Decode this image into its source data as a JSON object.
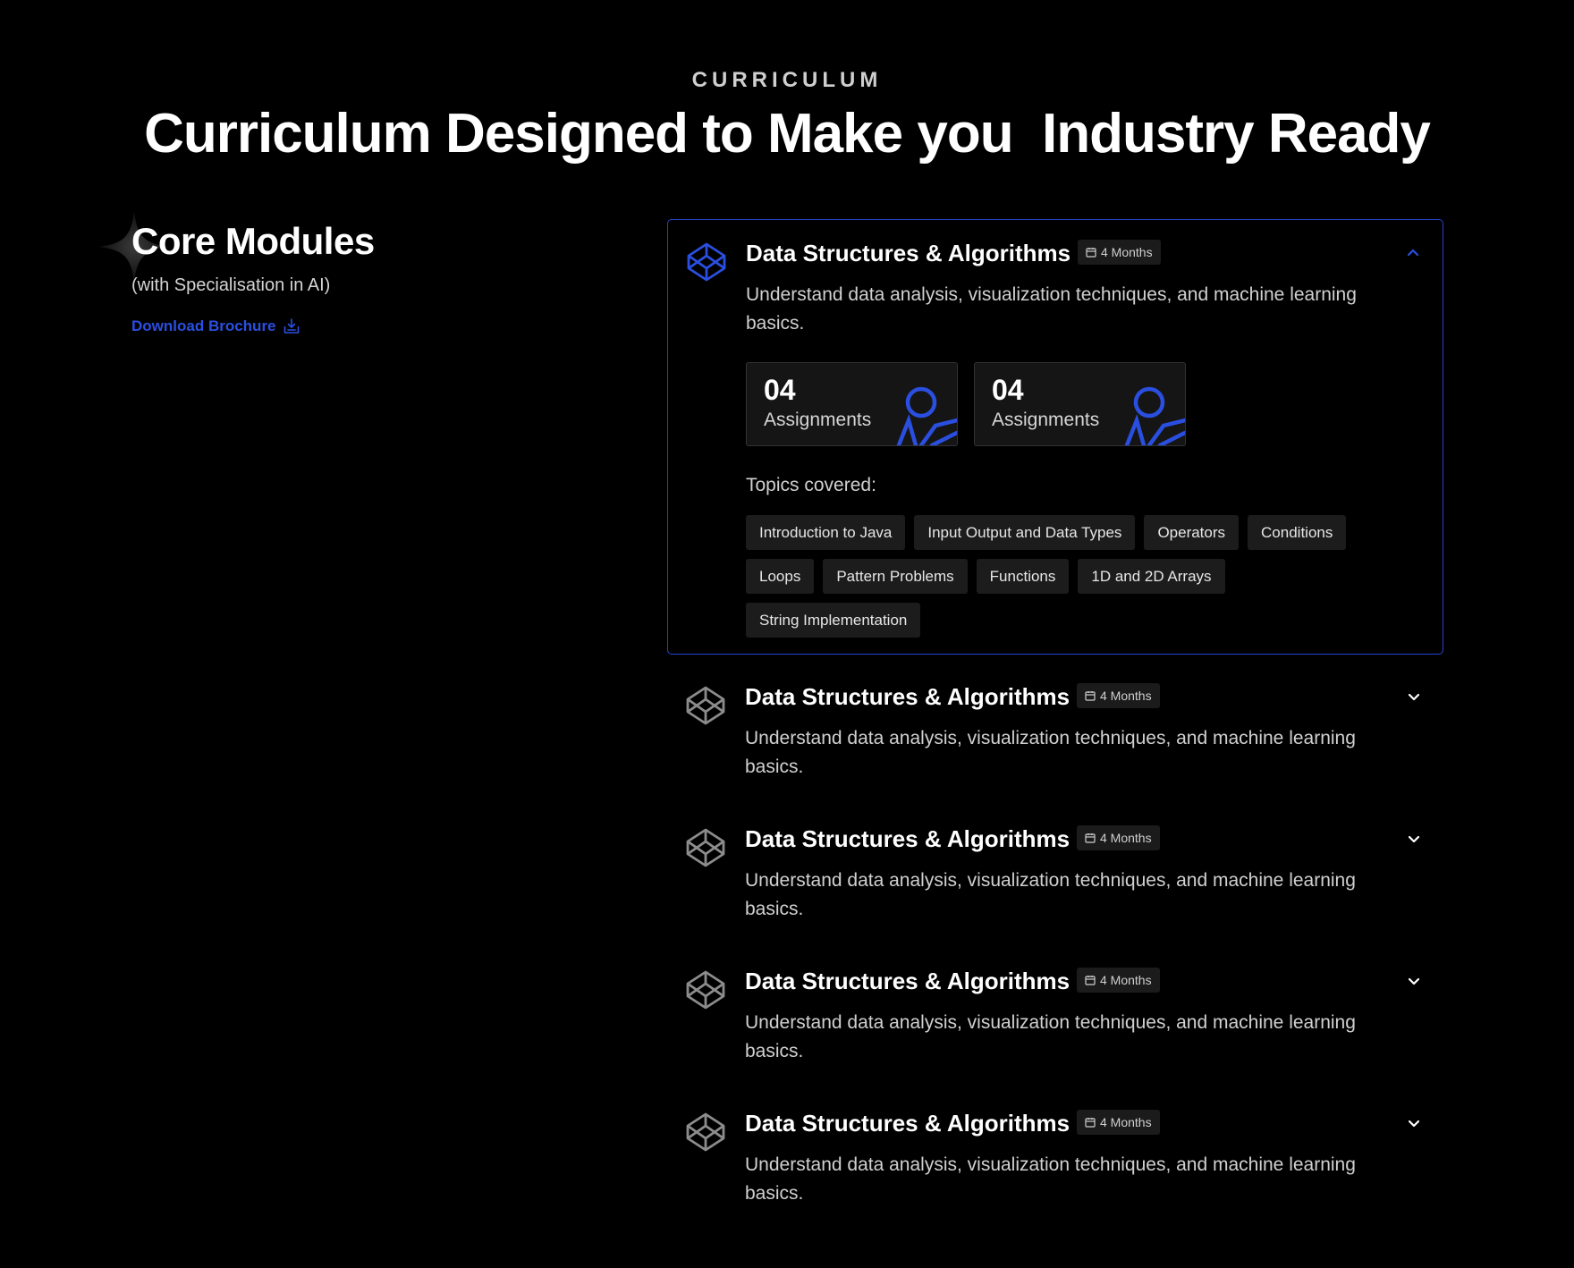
{
  "header": {
    "eyebrow": "CURRICULUM",
    "title": "Curriculum Designed to Make you  Industry Ready"
  },
  "left": {
    "title": "Core Modules",
    "subtitle": "(with Specialisation in AI)",
    "brochure_label": "Download Brochure",
    "sparkle_icon": "sparkle-icon",
    "download_icon": "download-icon"
  },
  "colors": {
    "background": "#000000",
    "accent": "#2a4fe0",
    "active_border": "#2742c9",
    "icon_muted": "#8c8c8c"
  },
  "modules": [
    {
      "title": "Data Structures & Algorithms",
      "duration": "4 Months",
      "description": "Understand data analysis, visualization techniques, and machine learning basics.",
      "expanded": true,
      "icon": "codepen-cube-icon",
      "stats": [
        {
          "value": "04",
          "label": "Assignments"
        },
        {
          "value": "04",
          "label": "Assignments"
        }
      ],
      "topics_label": "Topics covered:",
      "topics": [
        "Introduction to Java",
        "Input Output and Data Types",
        "Operators",
        "Conditions",
        "Loops",
        "Pattern Problems",
        "Functions",
        "1D and 2D Arrays",
        "String Implementation"
      ]
    },
    {
      "title": "Data Structures & Algorithms",
      "duration": "4 Months",
      "description": "Understand data analysis, visualization techniques, and machine learning basics.",
      "expanded": false,
      "icon": "codepen-cube-icon"
    },
    {
      "title": "Data Structures & Algorithms",
      "duration": "4 Months",
      "description": "Understand data analysis, visualization techniques, and machine learning basics.",
      "expanded": false,
      "icon": "codepen-cube-icon"
    },
    {
      "title": "Data Structures & Algorithms",
      "duration": "4 Months",
      "description": "Understand data analysis, visualization techniques, and machine learning basics.",
      "expanded": false,
      "icon": "codepen-cube-icon"
    },
    {
      "title": "Data Structures & Algorithms",
      "duration": "4 Months",
      "description": "Understand data analysis, visualization techniques, and machine learning basics.",
      "expanded": false,
      "icon": "codepen-cube-icon"
    }
  ]
}
